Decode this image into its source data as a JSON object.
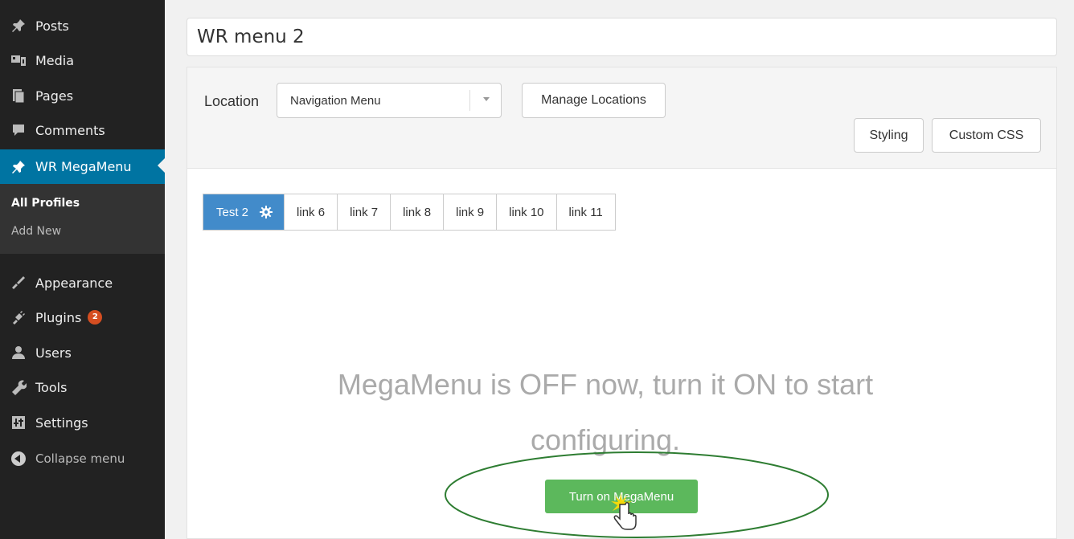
{
  "sidebar": {
    "items": [
      {
        "label": "Posts",
        "icon": "pin-icon"
      },
      {
        "label": "Media",
        "icon": "media-icon"
      },
      {
        "label": "Pages",
        "icon": "pages-icon"
      },
      {
        "label": "Comments",
        "icon": "comment-icon"
      },
      {
        "label": "WR MegaMenu",
        "icon": "pin-icon",
        "active": true
      },
      {
        "label": "Appearance",
        "icon": "brush-icon"
      },
      {
        "label": "Plugins",
        "icon": "plug-icon",
        "badge": "2"
      },
      {
        "label": "Users",
        "icon": "user-icon"
      },
      {
        "label": "Tools",
        "icon": "wrench-icon"
      },
      {
        "label": "Settings",
        "icon": "settings-icon"
      }
    ],
    "submenu": [
      {
        "label": "All Profiles",
        "current": true
      },
      {
        "label": "Add New"
      }
    ],
    "collapse_label": "Collapse menu"
  },
  "menu_title": "WR menu 2",
  "location": {
    "label": "Location",
    "selected": "Navigation Menu"
  },
  "buttons": {
    "manage_locations": "Manage Locations",
    "styling": "Styling",
    "custom_css": "Custom CSS",
    "turn_on": "Turn on MegaMenu"
  },
  "tabs": [
    {
      "label": "Test 2",
      "active": true
    },
    {
      "label": "link 6"
    },
    {
      "label": "link 7"
    },
    {
      "label": "link 8"
    },
    {
      "label": "link 9"
    },
    {
      "label": "link 10"
    },
    {
      "label": "link 11"
    }
  ],
  "off_message": "MegaMenu is OFF now, turn it ON to start configuring.",
  "colors": {
    "sidebar_bg": "#222222",
    "active_blue": "#0074a2",
    "tab_active": "#428bca",
    "success_green": "#5cb85c",
    "badge_orange": "#d54e21",
    "highlight_ellipse": "#2e7d32"
  }
}
